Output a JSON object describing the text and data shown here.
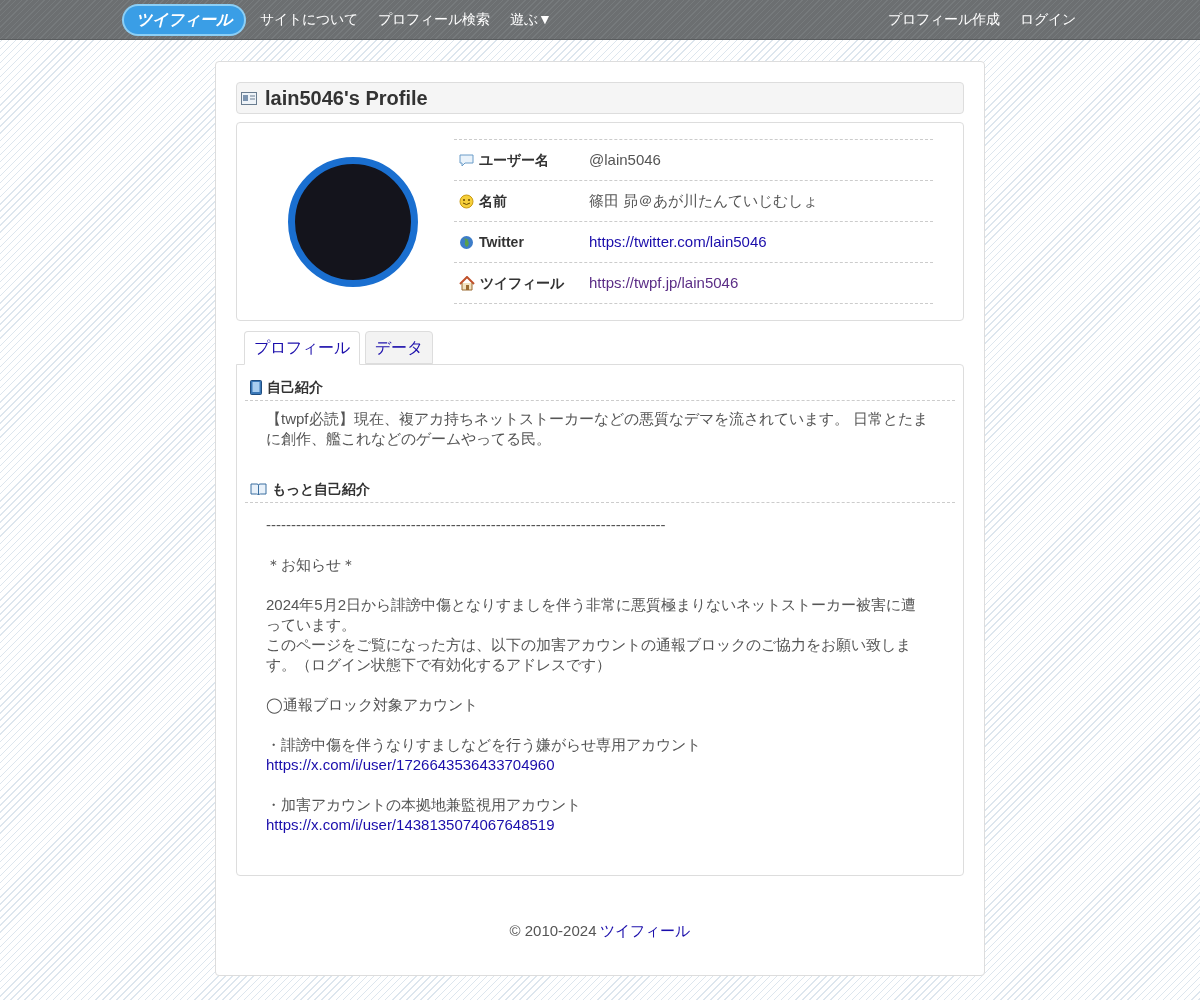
{
  "nav": {
    "logo": "ツイフィール",
    "left_links": [
      "サイトについて",
      "プロフィール検索",
      "遊ぶ▼"
    ],
    "right_links": [
      "プロフィール作成",
      "ログイン"
    ]
  },
  "profile_title": "lain5046's Profile",
  "profile_rows": [
    {
      "kind": "user",
      "label": "ユーザー名",
      "value": "@lain5046",
      "link": false
    },
    {
      "kind": "name",
      "label": "名前",
      "value": "篠田 昴＠あが川たんていじむしょ",
      "link": false
    },
    {
      "kind": "globe",
      "label": "Twitter",
      "value": "https://twitter.com/lain5046",
      "link": true,
      "visited": false
    },
    {
      "kind": "home",
      "label": "ツイフィール",
      "value": "https://twpf.jp/lain5046",
      "link": true,
      "visited": true
    }
  ],
  "tabs": [
    {
      "label": "プロフィール",
      "selected": true
    },
    {
      "label": "データ",
      "selected": false
    }
  ],
  "intro": {
    "heading": "自己紹介",
    "text": "【twpf必読】現在、複アカ持ちネットストーカーなどの悪質なデマを流されています。 日常とたまに創作、艦これなどのゲームやってる民。"
  },
  "more_intro": {
    "heading": "もっと自己紹介",
    "blocks": [
      {
        "kind": "text",
        "text": "--------------------------------------------------------------------------------"
      },
      {
        "kind": "text",
        "text": "＊お知らせ＊"
      },
      {
        "kind": "lines",
        "lines": [
          "2024年5月2日から誹謗中傷となりすましを伴う非常に悪質極まりないネットストーカー被害に遭っています。",
          "このページをご覧になった方は、以下の加害アカウントの通報ブロックのご協力をお願い致します。（ログイン状態下で有効化するアドレスです）"
        ]
      },
      {
        "kind": "text",
        "text": "◯通報ブロック対象アカウント"
      },
      {
        "kind": "entry",
        "text": "・誹謗中傷を伴うなりすましなどを行う嫌がらせ専用アカウント",
        "url": "https://x.com/i/user/1726643536433704960"
      },
      {
        "kind": "entry",
        "text": "・加害アカウントの本拠地兼監視用アカウント",
        "url": "https://x.com/i/user/1438135074067648519"
      }
    ]
  },
  "footer": {
    "copyright": "© 2010-2024",
    "link": "ツイフィール"
  }
}
